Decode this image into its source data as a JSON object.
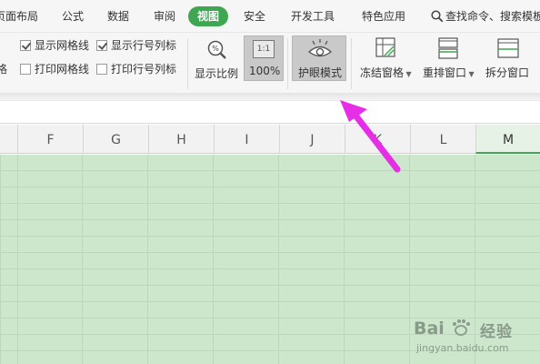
{
  "menu": {
    "items": [
      {
        "label": "页面布局"
      },
      {
        "label": "公式"
      },
      {
        "label": "数据"
      },
      {
        "label": "审阅"
      },
      {
        "label": "视图",
        "active": true
      },
      {
        "label": "安全"
      },
      {
        "label": "开发工具"
      },
      {
        "label": "特色应用"
      }
    ],
    "search_label": "查找命令、搜索模板"
  },
  "ribbon": {
    "left_edge_text": "格",
    "checkboxes": [
      {
        "label": "显示网格线",
        "checked": true
      },
      {
        "label": "显示行号列标",
        "checked": true
      },
      {
        "label": "打印网格线",
        "checked": false
      },
      {
        "label": "打印行号列标",
        "checked": false
      }
    ],
    "zoom_label": "显示比例",
    "zoom100_label": "100%",
    "zoom100_icon_text": "1:1",
    "eye_mode_label": "护眼模式",
    "freeze_label": "冻结窗格",
    "arrange_label": "重排窗口",
    "split_label": "拆分窗口"
  },
  "columns": [
    "F",
    "G",
    "H",
    "I",
    "J",
    "K",
    "L",
    "M"
  ],
  "selected_column": "M",
  "colors": {
    "accent_green": "#3fa752",
    "eye_care_green": "#cce7cc",
    "arrow_magenta": "#e62ee6"
  },
  "watermark": {
    "brand": "Bai",
    "brand_suffix": "经验",
    "url": "jingyan.baidu.com"
  }
}
